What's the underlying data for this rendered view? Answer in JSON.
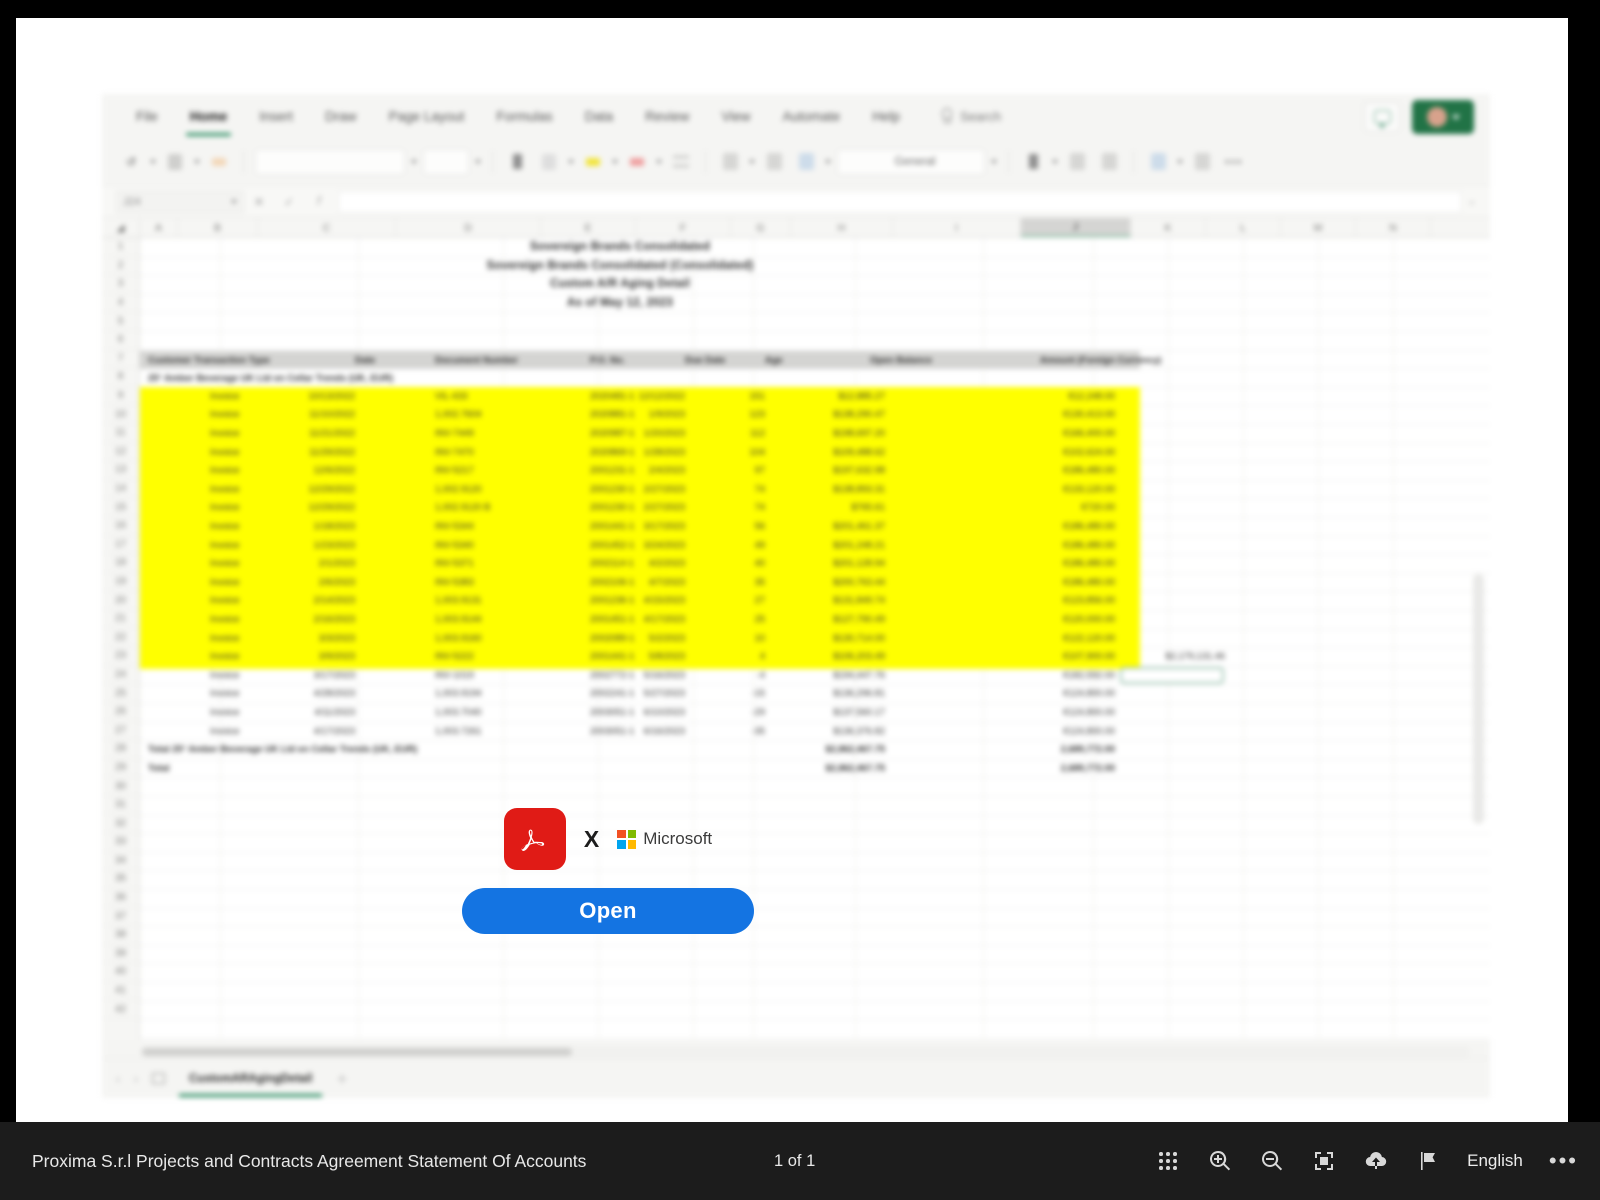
{
  "viewer": {
    "bottom_bar": {
      "document_title": "Proxima S.r.l Projects and Contracts Agreement Statement Of Accounts",
      "page_indicator": "1 of 1",
      "language": "English",
      "more_label": "•••",
      "tools": [
        {
          "name": "thumbnails-icon",
          "label": "Thumbnails"
        },
        {
          "name": "zoom-in-icon",
          "label": "Zoom In"
        },
        {
          "name": "zoom-out-icon",
          "label": "Zoom Out"
        },
        {
          "name": "fit-page-icon",
          "label": "Fit to Page"
        },
        {
          "name": "download-icon",
          "label": "Download"
        },
        {
          "name": "flag-icon",
          "label": "Report"
        }
      ]
    }
  },
  "open_prompt": {
    "acrobat_label": "Adobe Acrobat",
    "x_label": "X",
    "microsoft_label": "Microsoft",
    "open_button": "Open"
  },
  "excel": {
    "tabs": [
      {
        "label": "File",
        "active": false
      },
      {
        "label": "Home",
        "active": true
      },
      {
        "label": "Insert",
        "active": false
      },
      {
        "label": "Draw",
        "active": false
      },
      {
        "label": "Page Layout",
        "active": false
      },
      {
        "label": "Formulas",
        "active": false
      },
      {
        "label": "Data",
        "active": false
      },
      {
        "label": "Review",
        "active": false
      },
      {
        "label": "View",
        "active": false
      },
      {
        "label": "Automate",
        "active": false
      },
      {
        "label": "Help",
        "active": false
      }
    ],
    "search_placeholder": "Search",
    "number_format": "General",
    "name_box": "J24",
    "formula_bar": "",
    "sheet_tab": "CustomARAgingDetail",
    "columns": [
      "A",
      "B",
      "C",
      "D",
      "E",
      "F",
      "G",
      "H",
      "I",
      "J",
      "K",
      "L",
      "M",
      "N"
    ],
    "selected_column": "J",
    "selected_cell_value": "$2,179,131.46",
    "rows": [
      1,
      2,
      3,
      4,
      5,
      6,
      7,
      8,
      9,
      10,
      11,
      12,
      13,
      14,
      15,
      16,
      17,
      18,
      19,
      20,
      21,
      22,
      23,
      24,
      25,
      26,
      27,
      28,
      29,
      30,
      31,
      32,
      33,
      34,
      35,
      36,
      37,
      38,
      39,
      40,
      41,
      42
    ]
  },
  "report": {
    "title_lines": [
      "Sovereign Brands Consolidated",
      "Sovereign Brands Consolidated (Consolidated)",
      "Custom A/R Aging Detail",
      "As of May 12, 2023"
    ],
    "headers": [
      "Customer Transaction Type",
      "Date",
      "Document Number",
      "P.O. No.",
      "Due Date",
      "Age",
      "Open Balance",
      "Amount (Foreign Currency)"
    ],
    "group_label": "25° Amber Beverage UK Ltd en Cellar Trends (UK, EUR)",
    "rows": [
      {
        "type": "Invoice",
        "date": "10/13/2022",
        "doc": "VIL-433",
        "po": "2020481-1",
        "due": "12/12/2022",
        "age": "151",
        "balance": "$12,885.27",
        "foreign": "€12,248.00",
        "highlight": true
      },
      {
        "type": "Invoice",
        "date": "11/10/2022",
        "doc": "1,002.7604",
        "po": "2020881-1",
        "due": "1/9/2023",
        "age": "123",
        "balance": "$138,290.47",
        "foreign": "€130,413.00",
        "highlight": true
      },
      {
        "type": "Invoice",
        "date": "11/21/2022",
        "doc": "INV-7449",
        "po": "2020987-1",
        "due": "1/20/2023",
        "age": "112",
        "balance": "$198,697.20",
        "foreign": "€166,400.00",
        "highlight": true
      },
      {
        "type": "Invoice",
        "date": "11/29/2022",
        "doc": "INV-7470",
        "po": "2020869-1",
        "due": "1/28/2023",
        "age": "104",
        "balance": "$109,488.62",
        "foreign": "€102,624.00",
        "highlight": true
      },
      {
        "type": "Invoice",
        "date": "12/6/2022",
        "doc": "INV-5217",
        "po": "2001231-1",
        "due": "2/4/2023",
        "age": "97",
        "balance": "$197,632.98",
        "foreign": "€186,480.00",
        "highlight": true
      },
      {
        "type": "Invoice",
        "date": "12/29/2022",
        "doc": "1,002.9120",
        "po": "2001230-1",
        "due": "2/27/2023",
        "age": "74",
        "balance": "$138,893.31",
        "foreign": "€133,120.00",
        "highlight": true
      },
      {
        "type": "Invoice",
        "date": "12/29/2022",
        "doc": "1,002.9120 B",
        "po": "2001230-1",
        "due": "2/27/2023",
        "age": "74",
        "balance": "$765.61",
        "foreign": "€720.00",
        "highlight": true
      },
      {
        "type": "Invoice",
        "date": "1/18/2023",
        "doc": "INV-5344",
        "po": "2001441-1",
        "due": "3/17/2023",
        "age": "56",
        "balance": "$201,461.37",
        "foreign": "€186,480.00",
        "highlight": true
      },
      {
        "type": "Invoice",
        "date": "1/23/2023",
        "doc": "INV-5340",
        "po": "2001452-1",
        "due": "3/24/2023",
        "age": "49",
        "balance": "$201,248.21",
        "foreign": "€186,480.00",
        "highlight": true
      },
      {
        "type": "Invoice",
        "date": "2/1/2023",
        "doc": "INV-5371",
        "po": "2002114-1",
        "due": "4/2/2023",
        "age": "40",
        "balance": "$201,128.94",
        "foreign": "€186,480.00",
        "highlight": true
      },
      {
        "type": "Invoice",
        "date": "2/6/2023",
        "doc": "INV-5383",
        "po": "2002106-1",
        "due": "4/7/2023",
        "age": "35",
        "balance": "$200,763.44",
        "foreign": "€186,480.00",
        "highlight": true
      },
      {
        "type": "Invoice",
        "date": "2/14/2023",
        "doc": "1,003.9131",
        "po": "2001236-1",
        "due": "4/15/2023",
        "age": "27",
        "balance": "$131,849.74",
        "foreign": "€123,856.00",
        "highlight": true
      },
      {
        "type": "Invoice",
        "date": "2/16/2023",
        "doc": "1,003.9144",
        "po": "2001451-1",
        "due": "4/17/2023",
        "age": "25",
        "balance": "$127,790.49",
        "foreign": "€120,000.00",
        "highlight": true
      },
      {
        "type": "Invoice",
        "date": "3/3/2023",
        "doc": "1,003.9160",
        "po": "2002089-1",
        "due": "5/2/2023",
        "age": "10",
        "balance": "$130,714.00",
        "foreign": "€122,120.00",
        "highlight": true
      },
      {
        "type": "Invoice",
        "date": "3/9/2023",
        "doc": "INV-5222",
        "po": "2001441-1",
        "due": "5/8/2023",
        "age": "4",
        "balance": "$106,203.49",
        "foreign": "€107,900.00",
        "highlight": true
      },
      {
        "type": "Invoice",
        "date": "3/17/2023",
        "doc": "INV-1019",
        "po": "2002772-1",
        "due": "5/16/2023",
        "age": "-4",
        "balance": "$194,447.76",
        "foreign": "€182,592.00",
        "highlight": false
      },
      {
        "type": "Invoice",
        "date": "4/28/2023",
        "doc": "1,003.9194",
        "po": "2002241-1",
        "due": "5/27/2023",
        "age": "-15",
        "balance": "$136,296.81",
        "foreign": "€124,800.00",
        "highlight": false
      },
      {
        "type": "Invoice",
        "date": "4/11/2023",
        "doc": "1,003.7040",
        "po": "2003051-1",
        "due": "6/10/2023",
        "age": "-29",
        "balance": "$137,560.17",
        "foreign": "€124,800.00",
        "highlight": false
      },
      {
        "type": "Invoice",
        "date": "4/17/2023",
        "doc": "1,003.7261",
        "po": "2003051-1",
        "due": "6/16/2023",
        "age": "-35",
        "balance": "$136,376.82",
        "foreign": "€124,800.00",
        "highlight": false
      }
    ],
    "group_total": {
      "label": "Total  25° Amber Beverage UK Ltd en Cellar Trends (UK, EUR)",
      "balance": "$2,862,467.75",
      "foreign": "2,689,772.00"
    },
    "grand_total": {
      "label": "Total",
      "balance": "$2,862,467.75",
      "foreign": "2,689,772.00"
    }
  }
}
